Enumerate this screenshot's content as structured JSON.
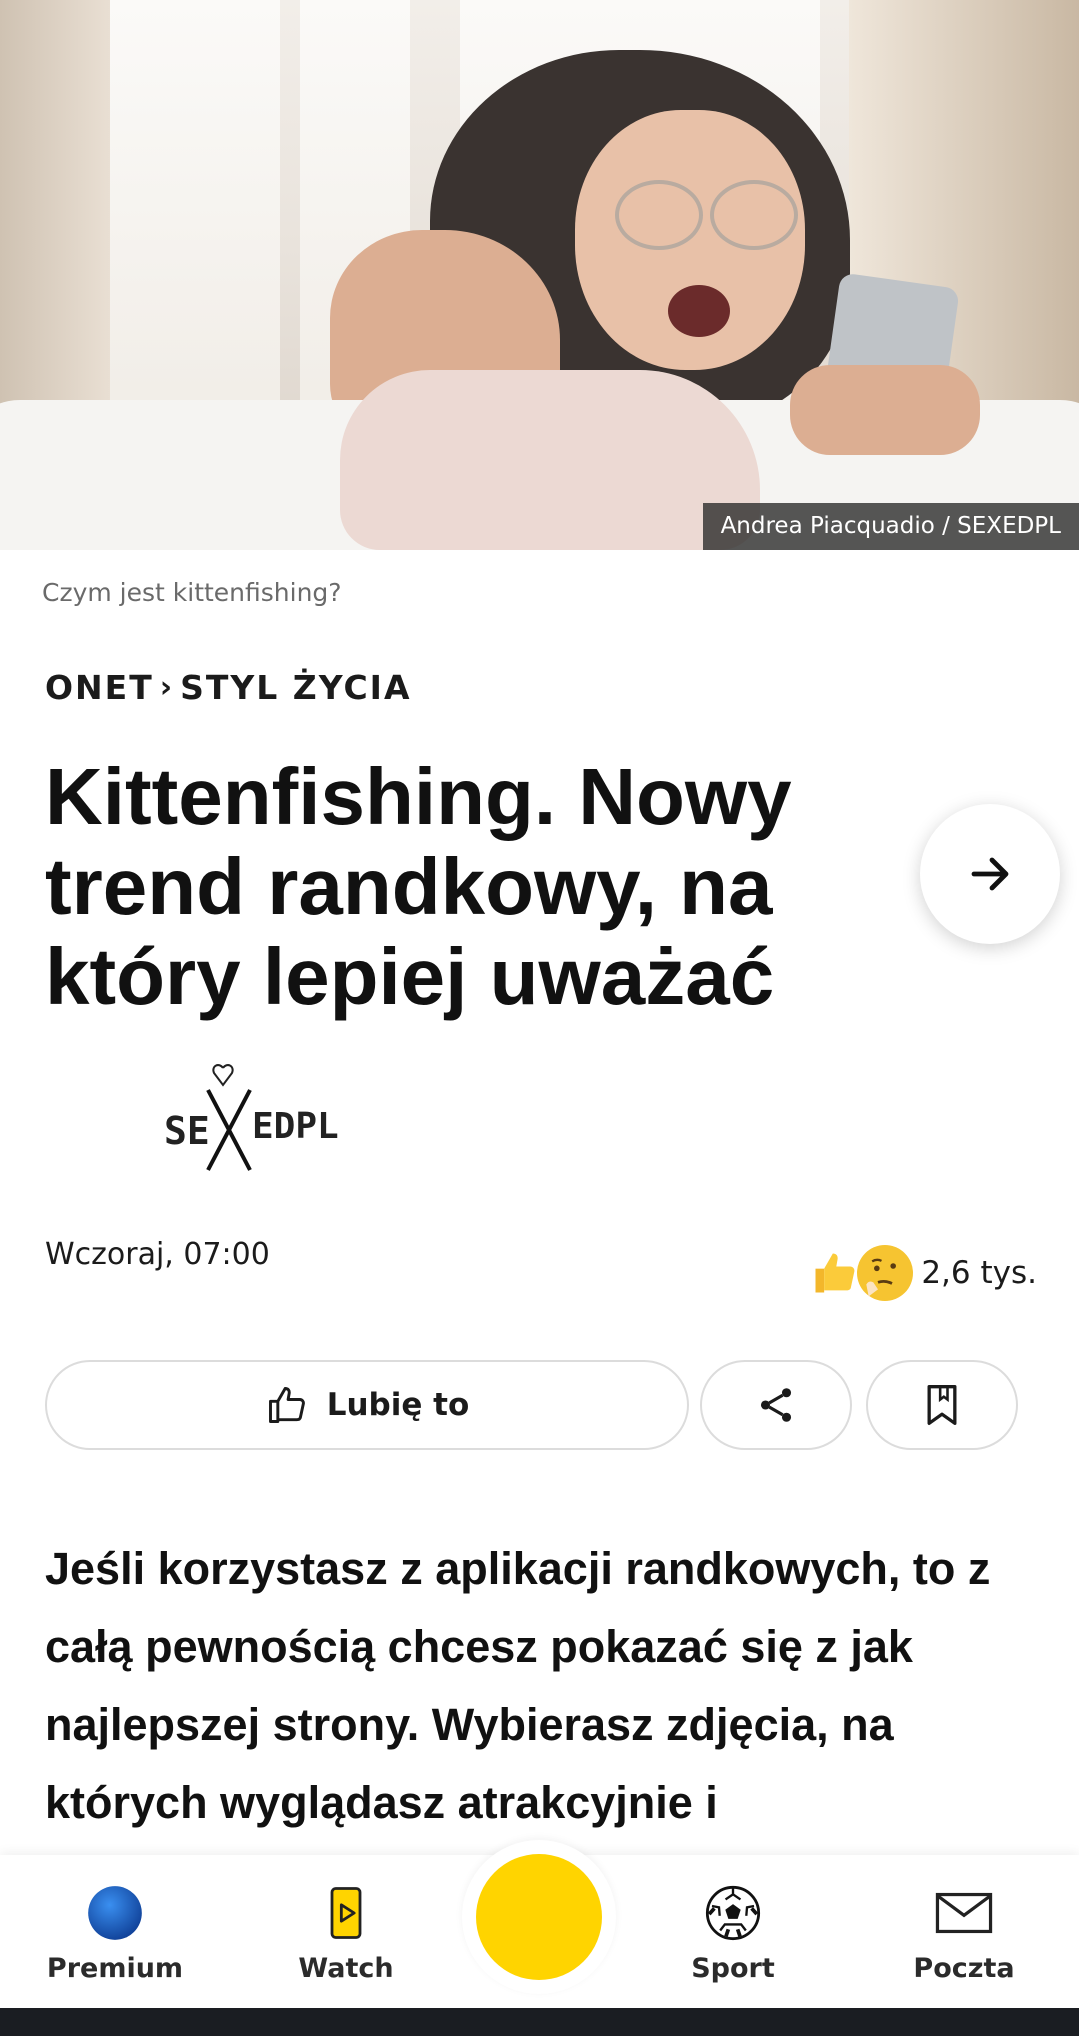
{
  "hero": {
    "credit": "Andrea Piacquadio / SEXEDPL",
    "caption": "Czym jest kittenfishing?"
  },
  "breadcrumb": {
    "site": "ONET",
    "separator": "›",
    "section": "STYL ŻYCIA"
  },
  "article": {
    "title": "Kittenfishing. Nowy trend randkowy, na który lepiej uważać",
    "author_logo_text": "SEXEDPL",
    "date": "Wczoraj, 07:00",
    "reactions_count": "2,6 tys.",
    "lead": "Jeśli korzystasz z aplikacji randkowych, to z całą pewnością chcesz pokazać się z jak najlepszej strony. Wybierasz zdjęcia, na których wyglądasz atrakcyjnie i"
  },
  "actions": {
    "like_label": "Lubię to",
    "share_icon": "share-icon",
    "save_icon": "bookmark-icon"
  },
  "bottom_nav": {
    "items": [
      {
        "label": "Premium",
        "icon": "premium-globe-icon"
      },
      {
        "label": "Watch",
        "icon": "watch-play-icon"
      },
      {
        "label": "Sport",
        "icon": "soccer-ball-icon"
      },
      {
        "label": "Poczta",
        "icon": "mail-envelope-icon"
      }
    ]
  },
  "colors": {
    "accent_yellow": "#ffd400",
    "premium_blue": "#1e5fbf"
  }
}
